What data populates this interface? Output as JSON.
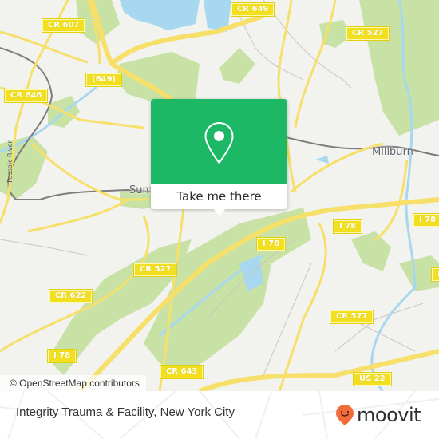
{
  "map": {
    "road_labels": [
      {
        "id": "cr-607",
        "text": "CR 607"
      },
      {
        "id": "cr-649-top",
        "text": "CR 649"
      },
      {
        "id": "cr-527-top",
        "text": "CR 527"
      },
      {
        "id": "649",
        "text": "(649)"
      },
      {
        "id": "cr-646",
        "text": "CR 646"
      },
      {
        "id": "i78-right",
        "text": "I 78"
      },
      {
        "id": "i78-mid",
        "text": "I 78"
      },
      {
        "id": "i78-center",
        "text": "I 78"
      },
      {
        "id": "cr-527-mid",
        "text": "CR 527"
      },
      {
        "id": "cr-622",
        "text": "CR 622"
      },
      {
        "id": "cr-577",
        "text": "CR 577"
      },
      {
        "id": "i78-left",
        "text": "I 78"
      },
      {
        "id": "cr-643",
        "text": "CR 643"
      },
      {
        "id": "us-22",
        "text": "US 22"
      },
      {
        "id": "edge-right",
        "text": "I"
      }
    ],
    "place_labels": {
      "millburn": "Millburn",
      "summit": "Summit",
      "passaic_river": "Passaic River"
    },
    "attribution": "© OpenStreetMap contributors",
    "colors": {
      "background": "#f2f2ee",
      "park": "#c8e2a6",
      "water": "#a8d8f0",
      "road": "#f7e06a",
      "shield": "#f2df1f"
    }
  },
  "popup": {
    "icon": "location-pin-icon",
    "button_label": "Take me there",
    "color": "#1db865"
  },
  "footer": {
    "title": "Integrity Trauma & Facility, New York City",
    "logo_text": "moovit",
    "logo_color": "#f26b3a"
  }
}
